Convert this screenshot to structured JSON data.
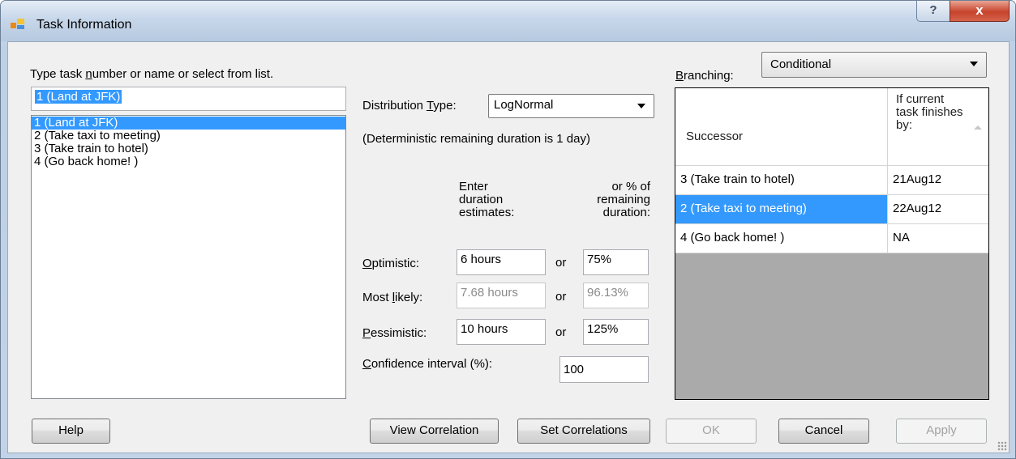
{
  "window": {
    "title": "Task Information",
    "help_glyph": "?",
    "close_glyph": "x"
  },
  "task_select": {
    "label_pre": "Type task ",
    "label_key": "n",
    "label_post": "umber or name or select from  list.",
    "input_value": "1 (Land at JFK)",
    "list_items": [
      "1 (Land at JFK)",
      "2 (Take taxi to meeting)",
      "3 (Take train to hotel)",
      "4 (Go back home! )"
    ],
    "selected_index": 0
  },
  "distribution": {
    "label_pre": "Distribution ",
    "label_key": "T",
    "label_post": "ype:",
    "value": "LogNormal",
    "note": "(Deterministic remaining  duration is 1 day)"
  },
  "estimates": {
    "col1_header": "Enter duration estimates:",
    "col2_header": "or %  of remaining duration:",
    "or_text": "or",
    "optimistic": {
      "label_key": "O",
      "label_post": "ptimistic:",
      "duration": "6 hours",
      "percent": "75%"
    },
    "most_likely": {
      "label_pre": "Most ",
      "label_key": "l",
      "label_post": "ikely:",
      "duration": "7.68 hours",
      "percent": "96.13%"
    },
    "pessimistic": {
      "label_key": "P",
      "label_post": "essimistic:",
      "duration": "10 hours",
      "percent": "125%"
    },
    "confidence": {
      "label_key": "C",
      "label_post": "onfidence interval (%):",
      "value": "100"
    }
  },
  "branching": {
    "label_key": "B",
    "label_post": "ranching:",
    "value": "Conditional",
    "grid": {
      "col_successor": "Successor",
      "col_finish": "If current task finishes by:",
      "rows": [
        {
          "successor": "3 (Take train to hotel)",
          "date": "21Aug12"
        },
        {
          "successor": "2 (Take taxi to meeting)",
          "date": "22Aug12"
        },
        {
          "successor": "4 (Go back home! )",
          "date": "NA"
        }
      ],
      "selected_row": 1
    }
  },
  "buttons": {
    "help": "Help",
    "view_correlation": "View Correlation",
    "set_correlations": "Set Correlations",
    "ok": "OK",
    "cancel": "Cancel",
    "apply": "Apply"
  },
  "colors": {
    "selection": "#3399ff",
    "grid_background": "#aaaaaa",
    "dialog_background": "#f0f0f0"
  }
}
